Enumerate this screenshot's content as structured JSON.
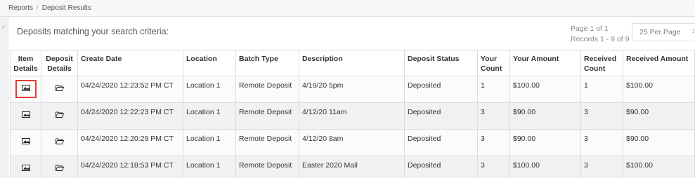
{
  "breadcrumb": {
    "items": [
      "Reports",
      "Deposit Results"
    ],
    "separator": "/"
  },
  "panel": {
    "title": "Deposits matching your search criteria:",
    "page_info": "Page 1 of 1",
    "records_info": "Records 1 - 9 of 9",
    "per_page": "25 Per Page"
  },
  "table": {
    "headers": {
      "item_details": [
        "Item",
        "Details"
      ],
      "deposit_details": [
        "Deposit",
        "Details"
      ],
      "create_date": "Create Date",
      "location": "Location",
      "batch_type": "Batch Type",
      "description": "Description",
      "deposit_status": "Deposit Status",
      "your_count": [
        "Your",
        "Count"
      ],
      "your_amount": "Your Amount",
      "received_count": [
        "Received",
        "Count"
      ],
      "received_amount": "Received Amount"
    },
    "rows": [
      {
        "create_date": "04/24/2020 12:23:52 PM CT",
        "location": "Location 1",
        "batch_type": "Remote Deposit",
        "description": "4/19/20 5pm",
        "deposit_status": "Deposited",
        "your_count": "1",
        "your_amount": "$100.00",
        "received_count": "1",
        "received_amount": "$100.00"
      },
      {
        "create_date": "04/24/2020 12:22:23 PM CT",
        "location": "Location 1",
        "batch_type": "Remote Deposit",
        "description": "4/12/20 11am",
        "deposit_status": "Deposited",
        "your_count": "3",
        "your_amount": "$90.00",
        "received_count": "3",
        "received_amount": "$90.00"
      },
      {
        "create_date": "04/24/2020 12:20:29 PM CT",
        "location": "Location 1",
        "batch_type": "Remote Deposit",
        "description": "4/12/20 8am",
        "deposit_status": "Deposited",
        "your_count": "3",
        "your_amount": "$90.00",
        "received_count": "3",
        "received_amount": "$90.00"
      },
      {
        "create_date": "04/24/2020 12:18:53 PM CT",
        "location": "Location 1",
        "batch_type": "Remote Deposit",
        "description": "Easter 2020 Mail",
        "deposit_status": "Deposited",
        "your_count": "3",
        "your_amount": "$100.00",
        "received_count": "3",
        "received_amount": "$100.00"
      }
    ]
  },
  "colors": {
    "highlight": "#e53935",
    "header_border": "#dcdce0",
    "row_alt": "#f0f1f3"
  },
  "icons": {
    "item_details": "image-icon",
    "deposit_details": "folder-open-icon",
    "sidebar_toggle": "chevron-right-icon",
    "select_caret": "chevron-updown-icon"
  }
}
